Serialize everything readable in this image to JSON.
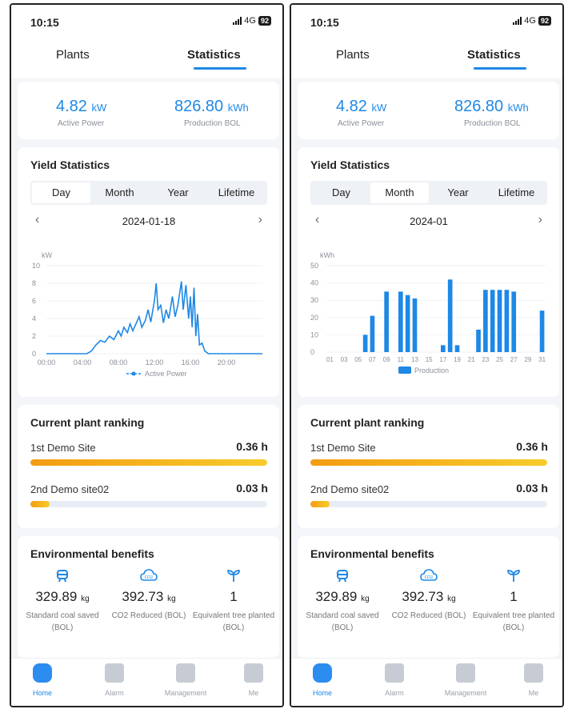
{
  "colors": {
    "accent": "#1e88e5",
    "bar_start": "#f39c12",
    "bar_end": "#f7cc2b"
  },
  "status": {
    "time": "10:15",
    "network": "4G",
    "battery": "92"
  },
  "tabs": {
    "plants": "Plants",
    "statistics": "Statistics"
  },
  "summary": {
    "active_power_value": "4.82",
    "active_power_unit": "kW",
    "active_power_label": "Active Power",
    "production_value": "826.80",
    "production_unit": "kWh",
    "production_label": "Production BOL"
  },
  "yield": {
    "title": "Yield Statistics",
    "periods": [
      "Day",
      "Month",
      "Year",
      "Lifetime"
    ],
    "prev_icon": "chevron-left-icon",
    "next_icon": "chevron-right-icon"
  },
  "screens": [
    {
      "active_period": 0,
      "date": "2024-01-18"
    },
    {
      "active_period": 1,
      "date": "2024-01"
    }
  ],
  "ranking": {
    "title": "Current plant ranking",
    "items": [
      {
        "name": "1st Demo Site",
        "value": "0.36 h",
        "fraction": 1.0
      },
      {
        "name": "2nd Demo site02",
        "value": "0.03 h",
        "fraction": 0.08
      }
    ]
  },
  "env": {
    "title": "Environmental benefits",
    "items": [
      {
        "icon": "coal-icon",
        "value": "329.89",
        "unit": "kg",
        "label": "Standard coal saved (BOL)"
      },
      {
        "icon": "co2-icon",
        "value": "392.73",
        "unit": "kg",
        "label": "CO2 Reduced (BOL)"
      },
      {
        "icon": "tree-icon",
        "value": "1",
        "unit": "",
        "label": "Equivalent tree planted (BOL)"
      }
    ]
  },
  "nav": {
    "items": [
      {
        "label": "Home",
        "icon": "home-icon"
      },
      {
        "label": "Alarm",
        "icon": "alarm-icon"
      },
      {
        "label": "Management",
        "icon": "management-icon"
      },
      {
        "label": "Me",
        "icon": "me-icon"
      }
    ]
  },
  "chart_data": [
    {
      "type": "line",
      "ylabel": "kW",
      "ylim": [
        0,
        10
      ],
      "yticks": [
        "0",
        "2",
        "4",
        "6",
        "8",
        "10"
      ],
      "xticks": [
        "00:00",
        "04:00",
        "08:00",
        "12:00",
        "16:00",
        "20:00"
      ],
      "xlim_hours": [
        0,
        24
      ],
      "legend": "top-bottom",
      "series": [
        {
          "name": "Active Power",
          "points": [
            [
              0,
              0
            ],
            [
              4.5,
              0
            ],
            [
              5.0,
              0.3
            ],
            [
              5.5,
              1.0
            ],
            [
              6.0,
              1.5
            ],
            [
              6.5,
              1.3
            ],
            [
              7.0,
              2.0
            ],
            [
              7.5,
              1.6
            ],
            [
              8.0,
              2.6
            ],
            [
              8.3,
              2.0
            ],
            [
              8.6,
              3.0
            ],
            [
              9.0,
              2.4
            ],
            [
              9.3,
              3.4
            ],
            [
              9.6,
              2.6
            ],
            [
              10.0,
              3.5
            ],
            [
              10.3,
              4.2
            ],
            [
              10.6,
              3.0
            ],
            [
              11.0,
              3.8
            ],
            [
              11.3,
              5.0
            ],
            [
              11.6,
              3.6
            ],
            [
              12.0,
              6.0
            ],
            [
              12.2,
              8.0
            ],
            [
              12.4,
              5.0
            ],
            [
              12.7,
              5.5
            ],
            [
              13.0,
              3.5
            ],
            [
              13.3,
              5.0
            ],
            [
              13.6,
              4.0
            ],
            [
              14.0,
              6.5
            ],
            [
              14.3,
              4.2
            ],
            [
              14.6,
              5.5
            ],
            [
              15.0,
              8.2
            ],
            [
              15.2,
              5.0
            ],
            [
              15.5,
              7.8
            ],
            [
              15.8,
              4.0
            ],
            [
              16.0,
              6.5
            ],
            [
              16.2,
              3.0
            ],
            [
              16.4,
              7.5
            ],
            [
              16.6,
              2.0
            ],
            [
              16.8,
              4.5
            ],
            [
              17.0,
              1.0
            ],
            [
              17.3,
              1.2
            ],
            [
              17.6,
              0.3
            ],
            [
              18.0,
              0
            ],
            [
              24,
              0
            ]
          ]
        }
      ]
    },
    {
      "type": "bar",
      "ylabel": "kWh",
      "ylim": [
        0,
        50
      ],
      "yticks": [
        "0",
        "10",
        "20",
        "30",
        "40",
        "50"
      ],
      "categories": [
        "01",
        "02",
        "03",
        "04",
        "05",
        "06",
        "07",
        "08",
        "09",
        "10",
        "11",
        "12",
        "13",
        "14",
        "15",
        "16",
        "17",
        "18",
        "19",
        "20",
        "21",
        "22",
        "23",
        "24",
        "25",
        "26",
        "27",
        "28",
        "29",
        "30",
        "31"
      ],
      "xtick_labels": [
        "01",
        "03",
        "05",
        "07",
        "09",
        "11",
        "13",
        "15",
        "17",
        "19",
        "21",
        "23",
        "25",
        "27",
        "29",
        "31"
      ],
      "series": [
        {
          "name": "Production",
          "values": [
            0,
            0,
            0,
            0,
            0,
            10,
            21,
            0,
            35,
            0,
            35,
            33,
            31,
            0,
            0,
            0,
            4,
            42,
            4,
            0,
            0,
            13,
            36,
            36,
            36,
            36,
            35,
            0,
            0,
            0,
            24
          ]
        }
      ]
    }
  ]
}
